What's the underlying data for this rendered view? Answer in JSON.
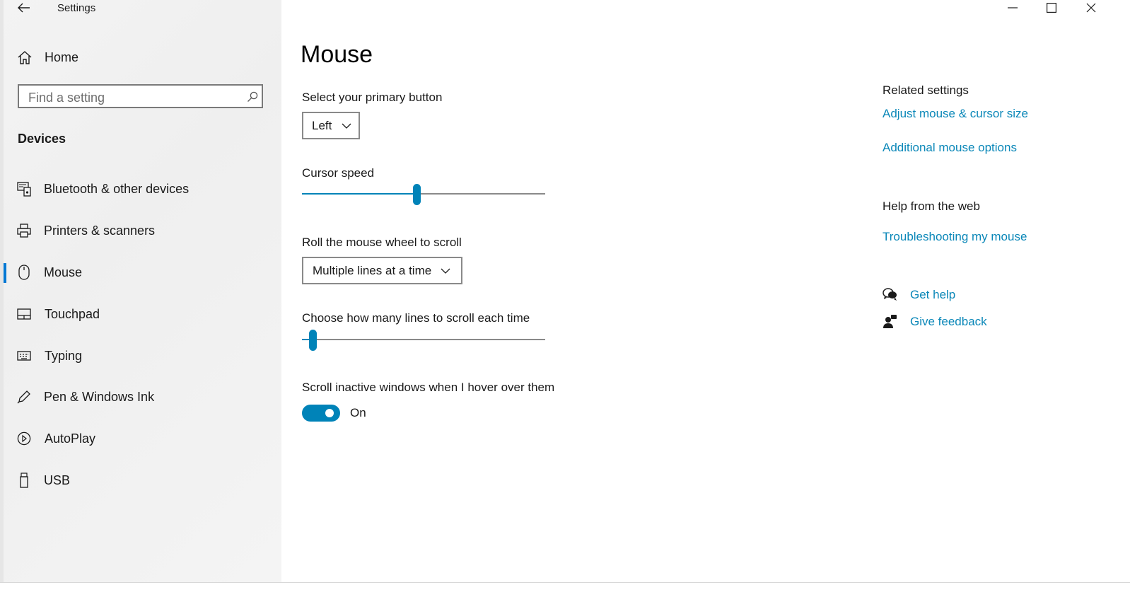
{
  "window": {
    "title": "Settings",
    "controls": {
      "minimize": "minimize-icon",
      "maximize": "maximize-icon",
      "close": "close-icon"
    }
  },
  "sidebar": {
    "home_label": "Home",
    "search_placeholder": "Find a setting",
    "section": "Devices",
    "items": [
      {
        "label": "Bluetooth & other devices",
        "icon": "bluetooth-devices-icon"
      },
      {
        "label": "Printers & scanners",
        "icon": "printer-icon"
      },
      {
        "label": "Mouse",
        "icon": "mouse-icon",
        "active": true
      },
      {
        "label": "Touchpad",
        "icon": "touchpad-icon"
      },
      {
        "label": "Typing",
        "icon": "keyboard-icon"
      },
      {
        "label": "Pen & Windows Ink",
        "icon": "pen-icon"
      },
      {
        "label": "AutoPlay",
        "icon": "autoplay-icon"
      },
      {
        "label": "USB",
        "icon": "usb-icon"
      }
    ]
  },
  "main": {
    "title": "Mouse",
    "primary_button": {
      "label": "Select your primary button",
      "value": "Left"
    },
    "cursor_speed": {
      "label": "Cursor speed",
      "level": 0.47
    },
    "scroll": {
      "label": "Roll the mouse wheel to scroll",
      "value": "Multiple lines at a time"
    },
    "lines": {
      "label": "Choose how many lines to scroll each time",
      "level": 0.03
    },
    "inactive": {
      "label": "Scroll inactive windows when I hover over them",
      "state": "On"
    }
  },
  "related": {
    "heading": "Related settings",
    "link1": "Adjust mouse & cursor size",
    "link2": "Additional mouse options",
    "help_heading": "Help from the web",
    "help_link": "Troubleshooting my mouse",
    "get_help": "Get help",
    "give_feedback": "Give feedback"
  },
  "colors": {
    "accent": "#0083b8",
    "link": "#0a87b8"
  }
}
